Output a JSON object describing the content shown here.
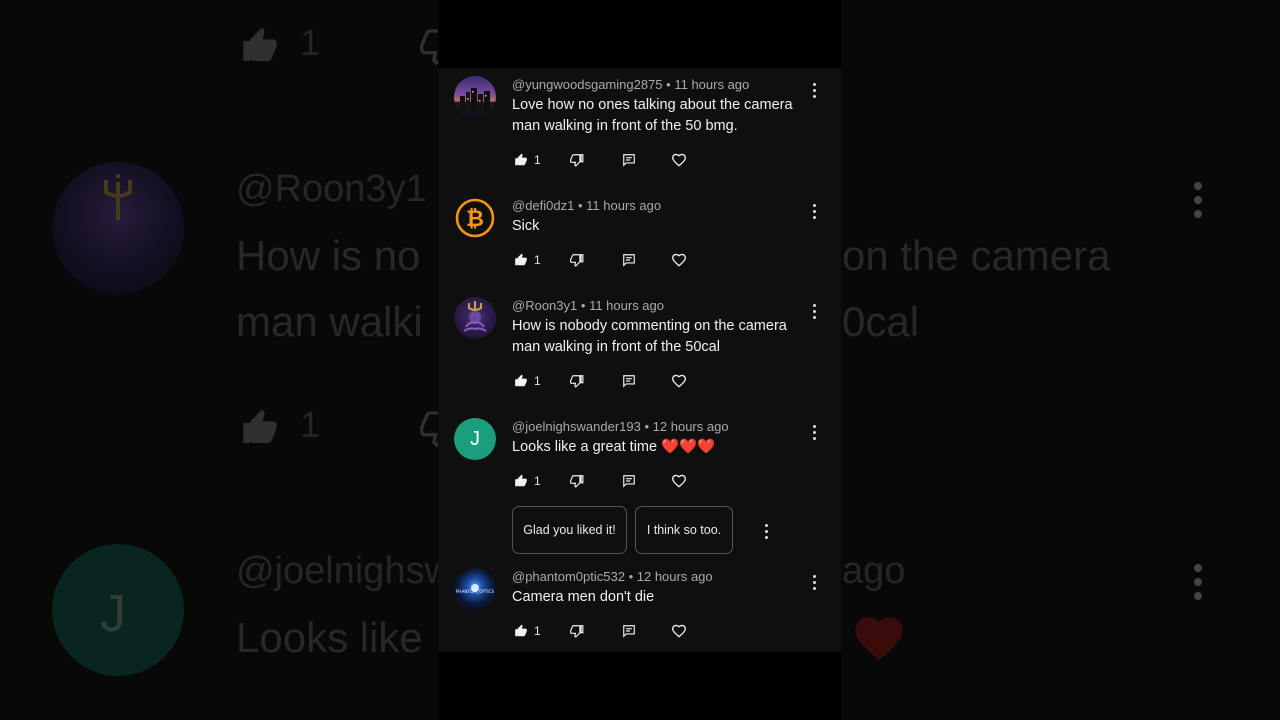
{
  "background": {
    "row1_handle": "@Roon3y1",
    "row1_text_a": "How is no",
    "row1_text_b": "on the camera",
    "row2_text_a": "man walki",
    "row2_text_b": "0cal",
    "thumb_count": "1",
    "row3_handle": "@joelnighsw",
    "row3_time": "ago",
    "row4_text": "Looks like",
    "avatar_letter": "J"
  },
  "comments": [
    {
      "handle": "@yungwoodsgaming2875",
      "time": "11 hours ago",
      "text": "Love how no ones talking about the camera man walking in front of the 50 bmg.",
      "likes": "1",
      "avatar": "city-night-icon"
    },
    {
      "handle": "@defi0dz1",
      "time": "11 hours ago",
      "text": "Sick",
      "likes": "1",
      "avatar": "bitcoin-icon"
    },
    {
      "handle": "@Roon3y1",
      "time": "11 hours ago",
      "text": "How is nobody commenting on the camera man walking in front of the 50cal",
      "likes": "1",
      "avatar": "octopus-king-icon"
    },
    {
      "handle": "@joelnighswander193",
      "time": "12 hours ago",
      "text": "Looks like a great time ❤️❤️❤️",
      "likes": "1",
      "avatar_letter": "J",
      "avatar_color": "#1a9e7d"
    },
    {
      "handle": "@phantom0ptic532",
      "time": "12 hours ago",
      "text": "Camera men don't die",
      "likes": "1",
      "avatar": "phantom-optics-icon",
      "avatar_label": "PHANTOM_OPTICS"
    }
  ],
  "suggested_replies": [
    "Glad you liked it!",
    "I think so too."
  ],
  "separator": "•"
}
